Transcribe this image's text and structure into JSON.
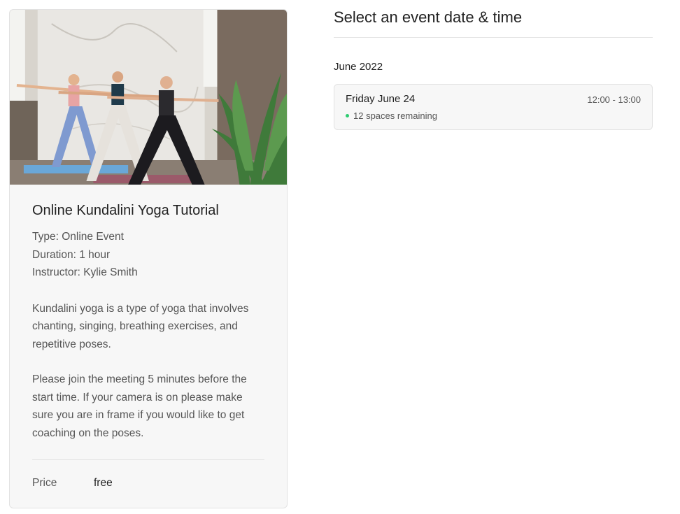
{
  "event": {
    "image_alt": "Three women doing warrior pose yoga in a bright studio",
    "title": "Online Kundalini Yoga Tutorial",
    "type_line": "Type: Online Event",
    "duration_line": "Duration: 1 hour",
    "instructor_line": "Instructor: Kylie Smith",
    "description": [
      "Kundalini yoga is a type of yoga that involves chanting, singing, breathing exercises, and repetitive poses.",
      "Please join the meeting 5 minutes before the start time. If your camera is on please make sure you are in frame if you would like to get coaching on the poses."
    ],
    "price_label": "Price",
    "price_value": "free"
  },
  "schedule": {
    "title": "Select an event date & time",
    "month": "June 2022",
    "slots": [
      {
        "day": "Friday June 24",
        "time": "12:00 - 13:00",
        "spaces": "12 spaces remaining"
      }
    ]
  },
  "colors": {
    "availability_dot": "#2ecc71",
    "card_bg": "#f7f7f7",
    "border": "#e2e2e2"
  }
}
